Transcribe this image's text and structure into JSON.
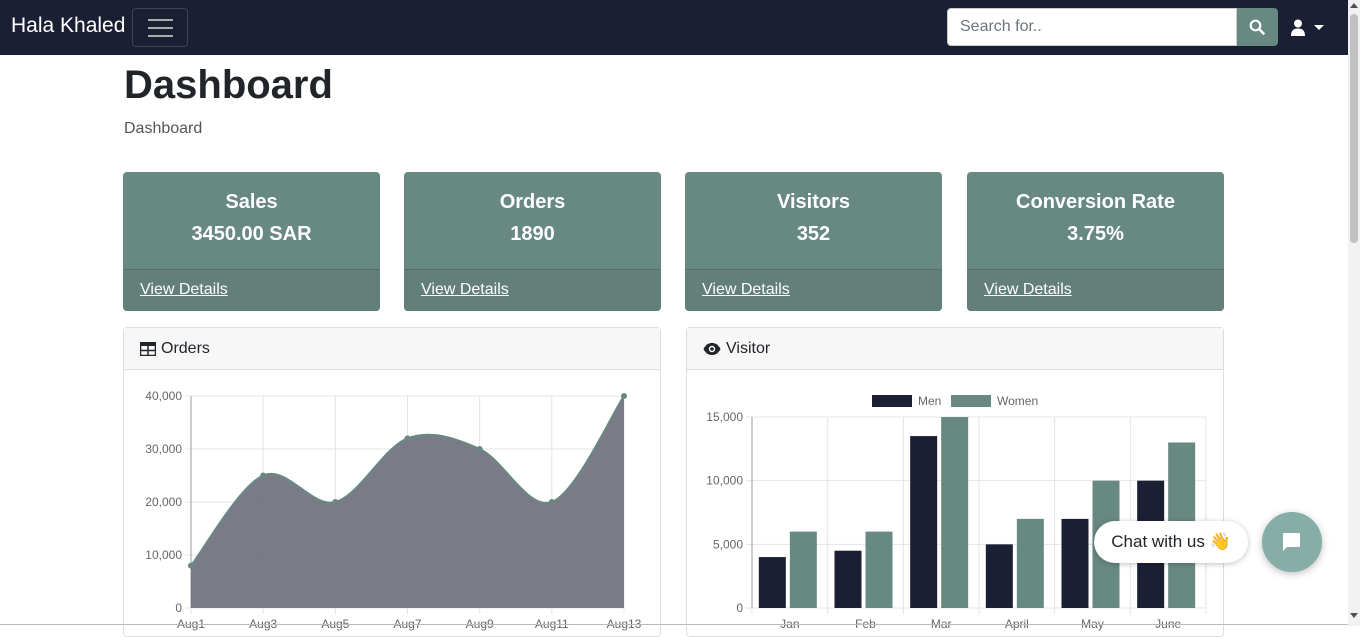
{
  "navbar": {
    "brand": "Hala Khaled",
    "search_placeholder": "Search for..",
    "toggle_icon": "hamburger-icon",
    "search_icon": "search-icon",
    "user_icon": "user-icon"
  },
  "page": {
    "title": "Dashboard",
    "breadcrumb": "Dashboard"
  },
  "cards": [
    {
      "title": "Sales",
      "value": "3450.00 SAR",
      "link": "View Details"
    },
    {
      "title": "Orders",
      "value": "1890",
      "link": "View Details"
    },
    {
      "title": "Visitors",
      "value": "352",
      "link": "View Details"
    },
    {
      "title": "Conversion Rate",
      "value": "3.75%",
      "link": "View Details"
    }
  ],
  "colors": {
    "navbar": "#1b1f33",
    "accent": "#688982",
    "dark_series": "#1b1f33",
    "area_fill": "#737480"
  },
  "orders_panel": {
    "title": "Orders",
    "icon": "table-icon"
  },
  "visitor_panel": {
    "title": "Visitor",
    "icon": "eye-icon"
  },
  "chart_data": [
    {
      "type": "area",
      "x": [
        "Aug1",
        "Aug3",
        "Aug5",
        "Aug7",
        "Aug9",
        "Aug11",
        "Aug13"
      ],
      "values": [
        8000,
        25000,
        20000,
        32000,
        30000,
        20000,
        40000
      ],
      "yticks": [
        "40,000",
        "30,000",
        "20,000",
        "10,000",
        "0"
      ],
      "ylim": [
        0,
        40000
      ],
      "grid": true
    },
    {
      "type": "bar",
      "categories": [
        "Jan",
        "Feb",
        "Mar",
        "April",
        "May",
        "June"
      ],
      "series": [
        {
          "name": "Men",
          "values": [
            4000,
            4500,
            13500,
            5000,
            7000,
            10000
          ]
        },
        {
          "name": "Women",
          "values": [
            6000,
            6000,
            15000,
            7000,
            10000,
            13000
          ]
        }
      ],
      "yticks": [
        "15,000",
        "10,000",
        "5,000",
        "0"
      ],
      "ylim": [
        0,
        15000
      ],
      "legend": "top",
      "grid": true
    }
  ],
  "chat": {
    "label": "Chat with us 👋",
    "icon": "chat-icon"
  }
}
